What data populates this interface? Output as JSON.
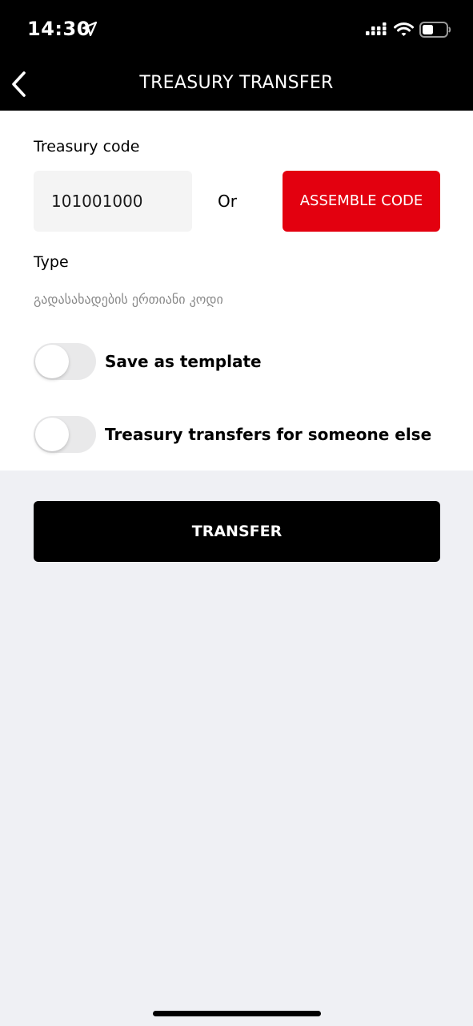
{
  "status_bar": {
    "time": "14:30",
    "icons": [
      "location-arrow-icon",
      "signal-icon",
      "wifi-icon",
      "battery-icon"
    ]
  },
  "header": {
    "title": "TREASURY TRANSFER",
    "back_icon": "chevron-left-icon"
  },
  "form": {
    "treasury_code_label": "Treasury code",
    "treasury_code_value": "101001000",
    "or_label": "Or",
    "assemble_button_label": "ASSEMBLE CODE",
    "type_label": "Type",
    "type_value": "გადასახადების ერთიანი კოდი",
    "save_template_label": "Save as template",
    "save_template_on": false,
    "someone_else_label": "Treasury transfers for someone else",
    "someone_else_on": false
  },
  "actions": {
    "transfer_label": "TRANSFER"
  },
  "colors": {
    "header_bg": "#000000",
    "accent_red": "#e3000f",
    "input_bg": "#f4f4f4",
    "page_bg": "#eff0f4"
  }
}
